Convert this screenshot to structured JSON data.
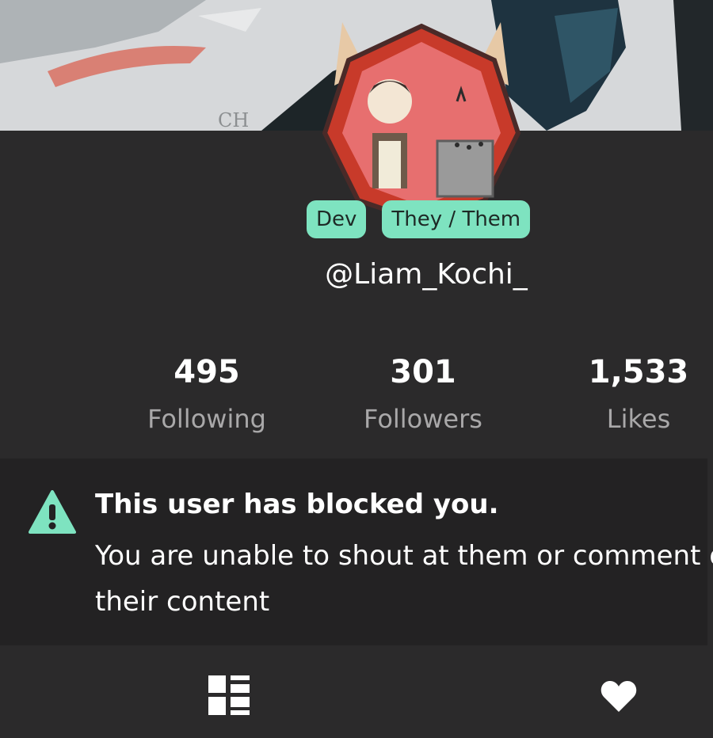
{
  "profile": {
    "tags": [
      "Dev",
      "They / Them"
    ],
    "username": "@Liam_Kochi_",
    "stats": [
      {
        "value": "495",
        "label": "Following"
      },
      {
        "value": "301",
        "label": "Followers"
      },
      {
        "value": "1,533",
        "label": "Likes"
      }
    ]
  },
  "notice": {
    "icon": "warning-icon",
    "title": "This user has blocked you.",
    "body": "You are unable to shout at them or comment on their content"
  },
  "tabs": [
    {
      "icon": "grid-icon"
    },
    {
      "icon": "heart-icon"
    }
  ],
  "colors": {
    "accent": "#7ee3c0",
    "background": "#2b2a2b",
    "notice_bg": "#232223"
  }
}
